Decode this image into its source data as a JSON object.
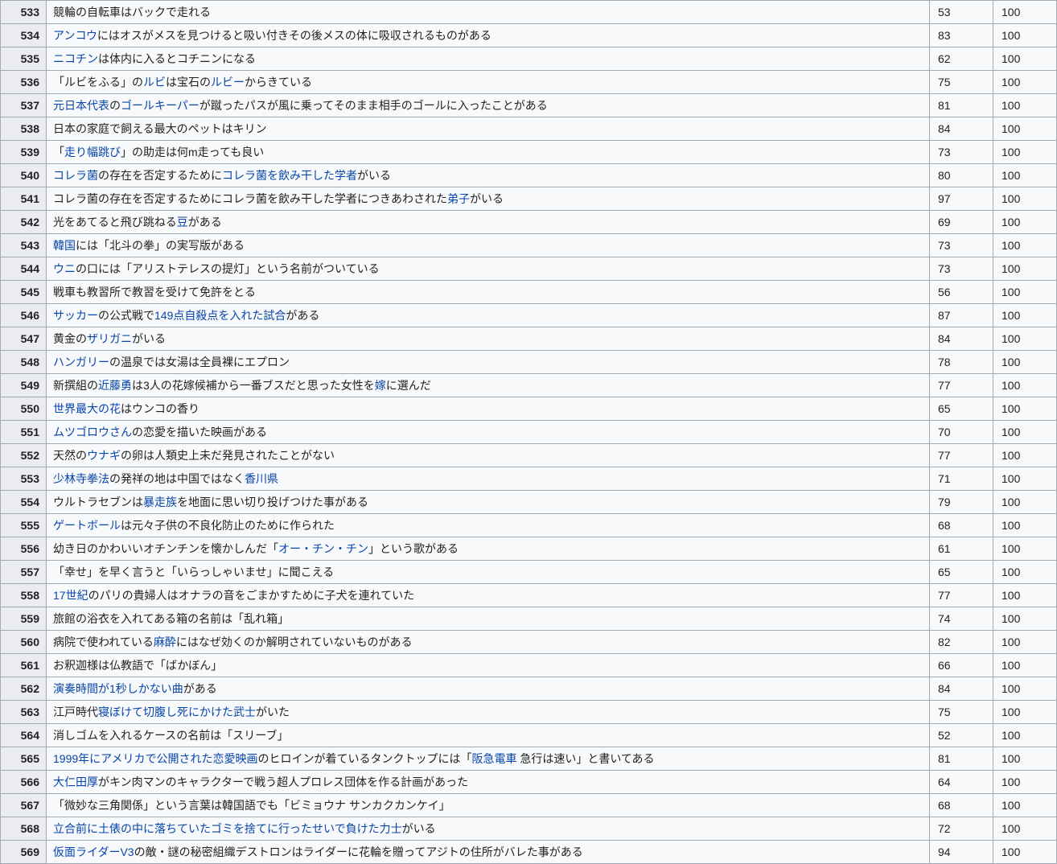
{
  "rows": [
    {
      "num": "533",
      "segments": [
        {
          "t": "競輪の自転車はバックで走れる"
        }
      ],
      "v1": "53",
      "v2": "100"
    },
    {
      "num": "534",
      "segments": [
        {
          "t": "アンコウ",
          "link": true
        },
        {
          "t": "にはオスがメスを見つけると吸い付きその後メスの体に吸収されるものがある"
        }
      ],
      "v1": "83",
      "v2": "100"
    },
    {
      "num": "535",
      "segments": [
        {
          "t": "ニコチン",
          "link": true
        },
        {
          "t": "は体内に入るとコチニンになる"
        }
      ],
      "v1": "62",
      "v2": "100"
    },
    {
      "num": "536",
      "segments": [
        {
          "t": "「ルビをふる」の"
        },
        {
          "t": "ルビ",
          "link": true
        },
        {
          "t": "は宝石の"
        },
        {
          "t": "ルビー",
          "link": true
        },
        {
          "t": "からきている"
        }
      ],
      "v1": "75",
      "v2": "100"
    },
    {
      "num": "537",
      "segments": [
        {
          "t": "元日本代表",
          "link": true
        },
        {
          "t": "の"
        },
        {
          "t": "ゴールキーパー",
          "link": true
        },
        {
          "t": "が蹴ったパスが風に乗ってそのまま相手のゴールに入ったことがある"
        }
      ],
      "v1": "81",
      "v2": "100"
    },
    {
      "num": "538",
      "segments": [
        {
          "t": "日本の家庭で飼える最大のペットはキリン"
        }
      ],
      "v1": "84",
      "v2": "100"
    },
    {
      "num": "539",
      "segments": [
        {
          "t": "「"
        },
        {
          "t": "走り幅跳び",
          "link": true
        },
        {
          "t": "」の助走は何m走っても良い"
        }
      ],
      "v1": "73",
      "v2": "100"
    },
    {
      "num": "540",
      "segments": [
        {
          "t": "コレラ菌",
          "link": true
        },
        {
          "t": "の存在を否定するために"
        },
        {
          "t": "コレラ菌を飲み干した学者",
          "link": true
        },
        {
          "t": "がいる"
        }
      ],
      "v1": "80",
      "v2": "100"
    },
    {
      "num": "541",
      "segments": [
        {
          "t": "コレラ菌の存在を否定するためにコレラ菌を飲み干した学者につきあわされた"
        },
        {
          "t": "弟子",
          "link": true
        },
        {
          "t": "がいる"
        }
      ],
      "v1": "97",
      "v2": "100"
    },
    {
      "num": "542",
      "segments": [
        {
          "t": "光をあてると飛び跳ねる"
        },
        {
          "t": "豆",
          "link": true
        },
        {
          "t": "がある"
        }
      ],
      "v1": "69",
      "v2": "100"
    },
    {
      "num": "543",
      "segments": [
        {
          "t": "韓国",
          "link": true
        },
        {
          "t": "には「北斗の拳」の実写版がある"
        }
      ],
      "v1": "73",
      "v2": "100"
    },
    {
      "num": "544",
      "segments": [
        {
          "t": "ウニ",
          "link": true
        },
        {
          "t": "の口には「アリストテレスの提灯」という名前がついている"
        }
      ],
      "v1": "73",
      "v2": "100"
    },
    {
      "num": "545",
      "segments": [
        {
          "t": "戦車も教習所で教習を受けて免許をとる"
        }
      ],
      "v1": "56",
      "v2": "100"
    },
    {
      "num": "546",
      "segments": [
        {
          "t": "サッカー",
          "link": true
        },
        {
          "t": "の公式戦で"
        },
        {
          "t": "149点自殺点を入れた試合",
          "link": true
        },
        {
          "t": "がある"
        }
      ],
      "v1": "87",
      "v2": "100"
    },
    {
      "num": "547",
      "segments": [
        {
          "t": "黄金の"
        },
        {
          "t": "ザリガニ",
          "link": true
        },
        {
          "t": "がいる"
        }
      ],
      "v1": "84",
      "v2": "100"
    },
    {
      "num": "548",
      "segments": [
        {
          "t": "ハンガリー",
          "link": true
        },
        {
          "t": "の温泉では女湯は全員裸にエプロン"
        }
      ],
      "v1": "78",
      "v2": "100"
    },
    {
      "num": "549",
      "segments": [
        {
          "t": "新撰組の"
        },
        {
          "t": "近藤勇",
          "link": true
        },
        {
          "t": "は3人の花嫁候補から一番ブスだと思った女性を"
        },
        {
          "t": "嫁",
          "link": true
        },
        {
          "t": "に選んだ"
        }
      ],
      "v1": "77",
      "v2": "100"
    },
    {
      "num": "550",
      "segments": [
        {
          "t": "世界最大の花",
          "link": true
        },
        {
          "t": "はウンコの香り"
        }
      ],
      "v1": "65",
      "v2": "100"
    },
    {
      "num": "551",
      "segments": [
        {
          "t": "ムツゴロウさん",
          "link": true
        },
        {
          "t": "の恋愛を描いた映画がある"
        }
      ],
      "v1": "70",
      "v2": "100"
    },
    {
      "num": "552",
      "segments": [
        {
          "t": "天然の"
        },
        {
          "t": "ウナギ",
          "link": true
        },
        {
          "t": "の卵は人類史上未だ発見されたことがない"
        }
      ],
      "v1": "77",
      "v2": "100"
    },
    {
      "num": "553",
      "segments": [
        {
          "t": "少林寺拳法",
          "link": true
        },
        {
          "t": "の発祥の地は中国ではなく"
        },
        {
          "t": "香川県",
          "link": true
        }
      ],
      "v1": "71",
      "v2": "100"
    },
    {
      "num": "554",
      "segments": [
        {
          "t": "ウルトラセブンは"
        },
        {
          "t": "暴走族",
          "link": true
        },
        {
          "t": "を地面に思い切り投げつけた事がある"
        }
      ],
      "v1": "79",
      "v2": "100"
    },
    {
      "num": "555",
      "segments": [
        {
          "t": "ゲートボール",
          "link": true
        },
        {
          "t": "は元々子供の不良化防止のために作られた"
        }
      ],
      "v1": "68",
      "v2": "100"
    },
    {
      "num": "556",
      "segments": [
        {
          "t": "幼き日のかわいいオチンチンを懐かしんだ「"
        },
        {
          "t": "オー・チン・チン",
          "link": true
        },
        {
          "t": "」という歌がある"
        }
      ],
      "v1": "61",
      "v2": "100"
    },
    {
      "num": "557",
      "segments": [
        {
          "t": "「幸せ」を早く言うと「いらっしゃいませ」に聞こえる"
        }
      ],
      "v1": "65",
      "v2": "100"
    },
    {
      "num": "558",
      "segments": [
        {
          "t": "17世紀",
          "link": true
        },
        {
          "t": "のパリの貴婦人はオナラの音をごまかすために子犬を連れていた"
        }
      ],
      "v1": "77",
      "v2": "100"
    },
    {
      "num": "559",
      "segments": [
        {
          "t": "旅館の浴衣を入れてある箱の名前は「乱れ箱」"
        }
      ],
      "v1": "74",
      "v2": "100"
    },
    {
      "num": "560",
      "segments": [
        {
          "t": "病院で使われている"
        },
        {
          "t": "麻酔",
          "link": true
        },
        {
          "t": "にはなぜ効くのか解明されていないものがある"
        }
      ],
      "v1": "82",
      "v2": "100"
    },
    {
      "num": "561",
      "segments": [
        {
          "t": "お釈迦様は仏教語で「ばかぼん」"
        }
      ],
      "v1": "66",
      "v2": "100"
    },
    {
      "num": "562",
      "segments": [
        {
          "t": "演奏時間が1秒しかない曲",
          "link": true
        },
        {
          "t": "がある"
        }
      ],
      "v1": "84",
      "v2": "100"
    },
    {
      "num": "563",
      "segments": [
        {
          "t": "江戸時代"
        },
        {
          "t": "寝ぼけて切腹し死にかけた武士",
          "link": true
        },
        {
          "t": "がいた"
        }
      ],
      "v1": "75",
      "v2": "100"
    },
    {
      "num": "564",
      "segments": [
        {
          "t": "消しゴムを入れるケースの名前は「スリーブ」"
        }
      ],
      "v1": "52",
      "v2": "100"
    },
    {
      "num": "565",
      "segments": [
        {
          "t": "1999年にアメリカで公開された恋愛映画",
          "link": true
        },
        {
          "t": "のヒロインが着ているタンクトップには「"
        },
        {
          "t": "阪急電車",
          "link": true
        },
        {
          "t": " 急行は速い」と書いてある"
        }
      ],
      "v1": "81",
      "v2": "100"
    },
    {
      "num": "566",
      "segments": [
        {
          "t": "大仁田厚",
          "link": true
        },
        {
          "t": "がキン肉マンのキャラクターで戦う超人プロレス団体を作る計画があった"
        }
      ],
      "v1": "64",
      "v2": "100"
    },
    {
      "num": "567",
      "segments": [
        {
          "t": "「微妙な三角関係」という言葉は韓国語でも「ビミョウナ サンカクカンケイ」"
        }
      ],
      "v1": "68",
      "v2": "100"
    },
    {
      "num": "568",
      "segments": [
        {
          "t": "立合前に土俵の中に落ちていたゴミを捨てに行ったせいで負けた力士",
          "link": true
        },
        {
          "t": "がいる"
        }
      ],
      "v1": "72",
      "v2": "100"
    },
    {
      "num": "569",
      "segments": [
        {
          "t": "仮面ライダーV3",
          "link": true
        },
        {
          "t": "の敵・謎の秘密組織デストロンはライダーに花輪を贈ってアジトの住所がバレた事がある"
        }
      ],
      "v1": "94",
      "v2": "100"
    }
  ]
}
